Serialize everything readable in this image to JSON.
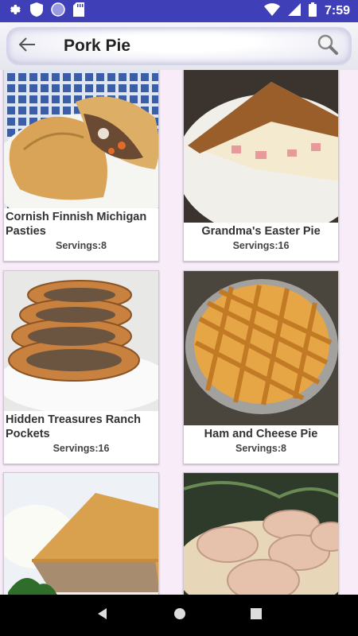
{
  "status_bar": {
    "time": "7:59",
    "icons": [
      "gear-icon",
      "shield-icon",
      "circle-icon",
      "sd-card-icon",
      "wifi-icon",
      "signal-icon",
      "battery-icon"
    ]
  },
  "search": {
    "query": "Pork Pie"
  },
  "recipes": [
    {
      "title": "Cornish Finnish Michigan Pasties",
      "servings": "Servings:8",
      "image": "hand pies on plate"
    },
    {
      "title": "Grandma's Easter Pie",
      "servings": "Servings:16",
      "image": "slice of ham pie"
    },
    {
      "title": "Hidden Treasures Ranch Pockets",
      "servings": "Servings:16",
      "image": "sliced meat roll"
    },
    {
      "title": "Ham and Cheese Pie",
      "servings": "Servings:8",
      "image": "lattice top pie"
    },
    {
      "title": "",
      "servings": "",
      "image": "slice of meat pie"
    },
    {
      "title": "",
      "servings": "",
      "image": "rolls on tray"
    }
  ],
  "colors": {
    "status_bar": "#3f3fb8",
    "background": "#f7ecf8"
  }
}
